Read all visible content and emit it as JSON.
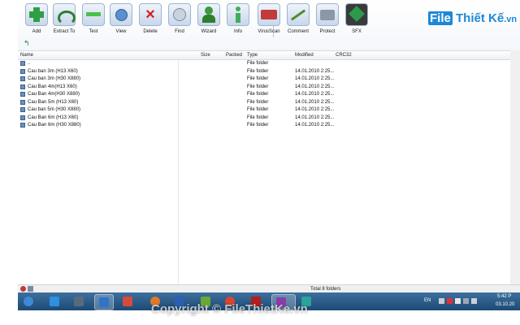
{
  "brand": {
    "prefix": "File",
    "name": "Thiết Kế",
    "suffix": ".vn"
  },
  "toolbar": {
    "buttons": [
      {
        "label": "Add",
        "icon": "add-archive-icon",
        "color": "#2ea043"
      },
      {
        "label": "Extract To",
        "icon": "extract-icon",
        "color": "#2f7d3a"
      },
      {
        "label": "Test",
        "icon": "test-icon",
        "color": "#4bbf4b"
      },
      {
        "label": "View",
        "icon": "view-icon",
        "color": "#5a8fd0"
      },
      {
        "label": "Delete",
        "icon": "delete-icon",
        "color": "#d11f1f"
      },
      {
        "label": "Find",
        "icon": "find-icon",
        "color": "#7a8aa0"
      },
      {
        "label": "Wizard",
        "icon": "wizard-icon",
        "color": "#3c9a3c"
      },
      {
        "label": "Info",
        "icon": "info-icon",
        "color": "#3fae5a"
      },
      {
        "label": "VirusScan",
        "icon": "virus-scan-icon",
        "color": "#c23b3b"
      },
      {
        "label": "Comment",
        "icon": "comment-icon",
        "color": "#4e8f2e"
      },
      {
        "label": "Protect",
        "icon": "protect-icon",
        "color": "#8c98a8"
      },
      {
        "label": "SFX",
        "icon": "sfx-icon",
        "color": "#2b9a4b"
      }
    ]
  },
  "columns": {
    "name": "Name",
    "size": "Size",
    "packed": "Packed",
    "type": "Type",
    "modified": "Modified",
    "crc": "CRC32"
  },
  "rows": [
    {
      "name": "..",
      "type": "File folder",
      "modified": ""
    },
    {
      "name": "Cau ban 3m (H13 X60)",
      "type": "File folder",
      "modified": "14.01.2010 2:25..."
    },
    {
      "name": "Cau ban 3m (H30 X880)",
      "type": "File folder",
      "modified": "14.01.2010 2:25..."
    },
    {
      "name": "Cau Ban 4m(H13 X60)",
      "type": "File folder",
      "modified": "14.01.2010 2:25..."
    },
    {
      "name": "Cau Ban 4m(H30 X880)",
      "type": "File folder",
      "modified": "14.01.2010 2:25..."
    },
    {
      "name": "Cau Ban 5m (H13 X60)",
      "type": "File folder",
      "modified": "14.01.2010 2:25..."
    },
    {
      "name": "Cau ban 5m (H30 X880)",
      "type": "File folder",
      "modified": "14.01.2010 2:25..."
    },
    {
      "name": "Cau Ban 6m (H13 X60)",
      "type": "File folder",
      "modified": "14.01.2010 2:25..."
    },
    {
      "name": "Cau Ban 6m (H30 X880)",
      "type": "File folder",
      "modified": "14.01.2010 2:25..."
    }
  ],
  "status": {
    "text": "Total 8 folders"
  },
  "taskbar": {
    "apps": [
      {
        "icon": "windows-start-icon",
        "color": "#3c8ad8"
      },
      {
        "icon": "internet-explorer-icon",
        "color": "#2f8fe0"
      },
      {
        "icon": "calculator-icon",
        "color": "#5b6a7b"
      },
      {
        "icon": "notebook-icon",
        "color": "#2f74c8"
      },
      {
        "icon": "media-player-icon",
        "color": "#d84a3a"
      },
      {
        "icon": "firefox-icon",
        "color": "#e0782a"
      },
      {
        "icon": "word-icon",
        "color": "#2b5fb4"
      },
      {
        "icon": "photo-editor-icon",
        "color": "#6aa832"
      },
      {
        "icon": "chrome-icon",
        "color": "#d9452f"
      },
      {
        "icon": "game-icon",
        "color": "#b41e1e"
      },
      {
        "icon": "winrar-icon",
        "color": "#8a3ca8"
      },
      {
        "icon": "autocad-icon",
        "color": "#2aa39b"
      }
    ],
    "lang": "EN",
    "time": "5:42 P",
    "date": "03.10.20"
  },
  "watermark": "Copyright © FileThietKe.vn"
}
